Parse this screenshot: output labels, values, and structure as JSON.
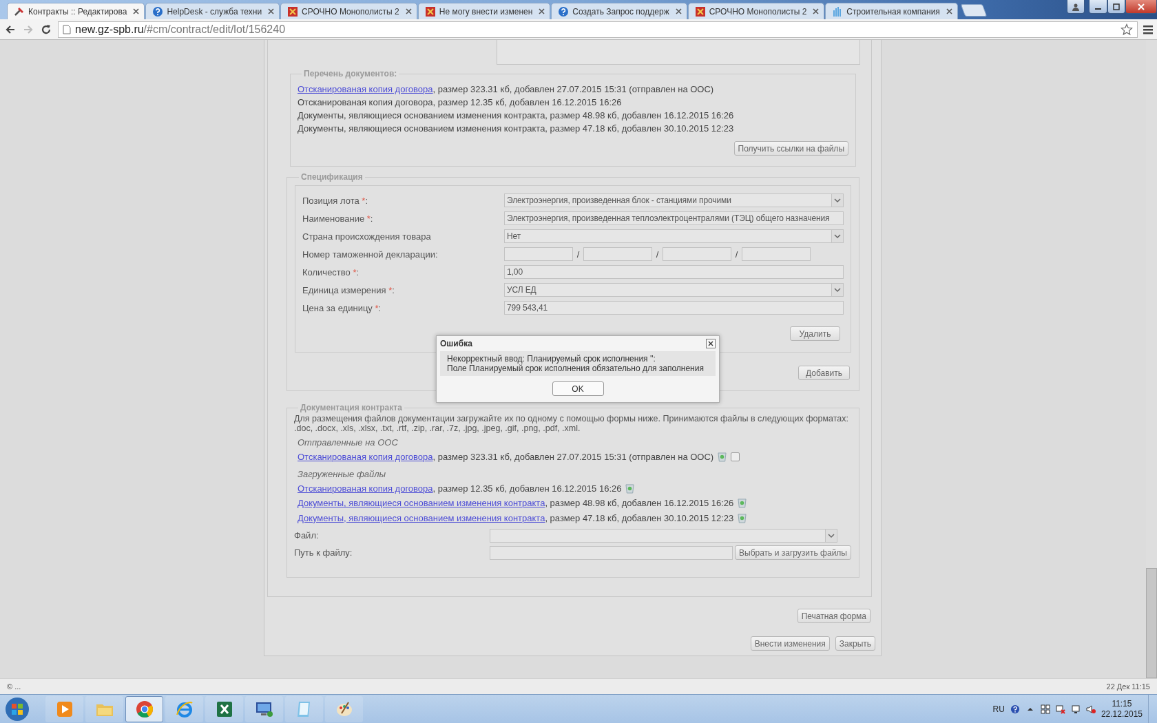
{
  "browser": {
    "tabs": [
      {
        "title": "Контракты :: Редактирова",
        "selected": true,
        "kind": "tools"
      },
      {
        "title": "HelpDesk - служба техни",
        "selected": false,
        "kind": "help"
      },
      {
        "title": "СРОЧНО Монополисты 2",
        "selected": false,
        "kind": "emblem"
      },
      {
        "title": "Не могу внести изменен",
        "selected": false,
        "kind": "emblem"
      },
      {
        "title": "Создать Запрос поддерж",
        "selected": false,
        "kind": "help"
      },
      {
        "title": "СРОЧНО Монополисты 2",
        "selected": false,
        "kind": "emblem"
      },
      {
        "title": "Строительная компания",
        "selected": false,
        "kind": "chart"
      }
    ],
    "url_host": "new.gz-spb.ru",
    "url_path": "/#cm/contract/edit/lot/156240",
    "forward_disabled": true
  },
  "documents_list": {
    "legend": "Перечень документов:",
    "items": [
      {
        "link": "Отсканированая копия договора",
        "text": ", размер 323.31 кб, добавлен 27.07.2015 15:31 (отправлен на ООС)"
      },
      {
        "text": "Отсканированая копия договора, размер 12.35 кб, добавлен 16.12.2015 16:26"
      },
      {
        "text": "Документы, являющиеся основанием изменения контракта, размер 48.98 кб, добавлен 16.12.2015 16:26"
      },
      {
        "text": "Документы, являющиеся основанием изменения контракта, размер 47.18 кб, добавлен 30.10.2015 12:23"
      }
    ],
    "button": "Получить ссылки на файлы"
  },
  "specification": {
    "legend": "Спецификация",
    "fields": [
      {
        "kind": "select",
        "label": "Позиция лота",
        "required_mark": "*",
        "label_suffix": ":",
        "value": "Электроэнергия, произведенная блок - станциями прочими"
      },
      {
        "kind": "text",
        "label": "Наименование",
        "required_mark": "*",
        "label_suffix": ":",
        "value": "Электроэнергия, произведенная теплоэлектроцентралями (ТЭЦ) общего назначения"
      },
      {
        "kind": "select",
        "label": "Страна происхождения товара",
        "value": "Нет"
      },
      {
        "kind": "split",
        "label": "Номер таможенной декларации:",
        "separators": [
          "/",
          "/",
          "/"
        ]
      },
      {
        "kind": "text",
        "label": "Количество",
        "required_mark": "*",
        "label_suffix": ":",
        "value": "1,00"
      },
      {
        "kind": "select",
        "label": "Единица измерения",
        "required_mark": "*",
        "label_suffix": ":",
        "value": "УСЛ ЕД"
      },
      {
        "kind": "text",
        "label": "Цена за единицу",
        "required_mark": "*",
        "label_suffix": ":",
        "value": "799 543,41"
      }
    ],
    "delete_button": "Удалить",
    "add_button": "Добавить"
  },
  "contract_docs": {
    "legend": "Документация контракта",
    "hint": "Для размещения файлов документации загружайте их по одному с помощью формы ниже. Принимаются файлы в следующих форматах: .doc, .docx, .xls, .xlsx, .txt, .rtf, .zip, .rar, .7z, .jpg, .jpeg, .gif, .png, .pdf, .xml.",
    "groups": [
      {
        "title": "Отправленные на ООС",
        "items": [
          {
            "link": "Отсканированая копия договора",
            "text": ", размер 323.31 кб, добавлен 27.07.2015 15:31 (отправлен на ООС)",
            "checked": false
          }
        ]
      },
      {
        "title": "Загруженные файлы",
        "items": [
          {
            "link": "Отсканированая копия договора",
            "text": ", размер 12.35 кб, добавлен 16.12.2015 16:26"
          },
          {
            "link": "Документы, являющиеся основанием изменения контракта",
            "text": ", размер 48.98 кб, добавлен 16.12.2015 16:26"
          },
          {
            "link": "Документы, являющиеся основанием изменения контракта",
            "text": ", размер 47.18 кб, добавлен 30.10.2015 12:23"
          }
        ]
      }
    ],
    "file_label": "Файл:",
    "path_label": "Путь к файлу:",
    "upload_button": "Выбрать и загрузить файлы"
  },
  "print_button": "Печатная форма",
  "actions": [
    "Внести изменения",
    "Закрыть"
  ],
  "dialog": {
    "title": "Ошибка",
    "lines": [
      "Некорректный ввод: Планируемый срок исполнения '':",
      "Поле Планируемый срок исполнения обязательно для заполнения"
    ],
    "ok": "OK"
  },
  "status_bar": {
    "left": "© ...",
    "right": "22 Дек 11:15"
  },
  "taskbar": {
    "apps": [
      {
        "kind": "media",
        "selected": false
      },
      {
        "kind": "folder",
        "selected": false
      },
      {
        "kind": "chrome",
        "selected": true
      },
      {
        "kind": "ie",
        "selected": false
      },
      {
        "kind": "excel",
        "selected": false
      },
      {
        "kind": "rdp",
        "selected": false
      },
      {
        "kind": "notepad",
        "selected": false
      },
      {
        "kind": "paint",
        "selected": false
      }
    ],
    "lang": "RU",
    "time": "11:15",
    "date": "22.12.2015"
  }
}
